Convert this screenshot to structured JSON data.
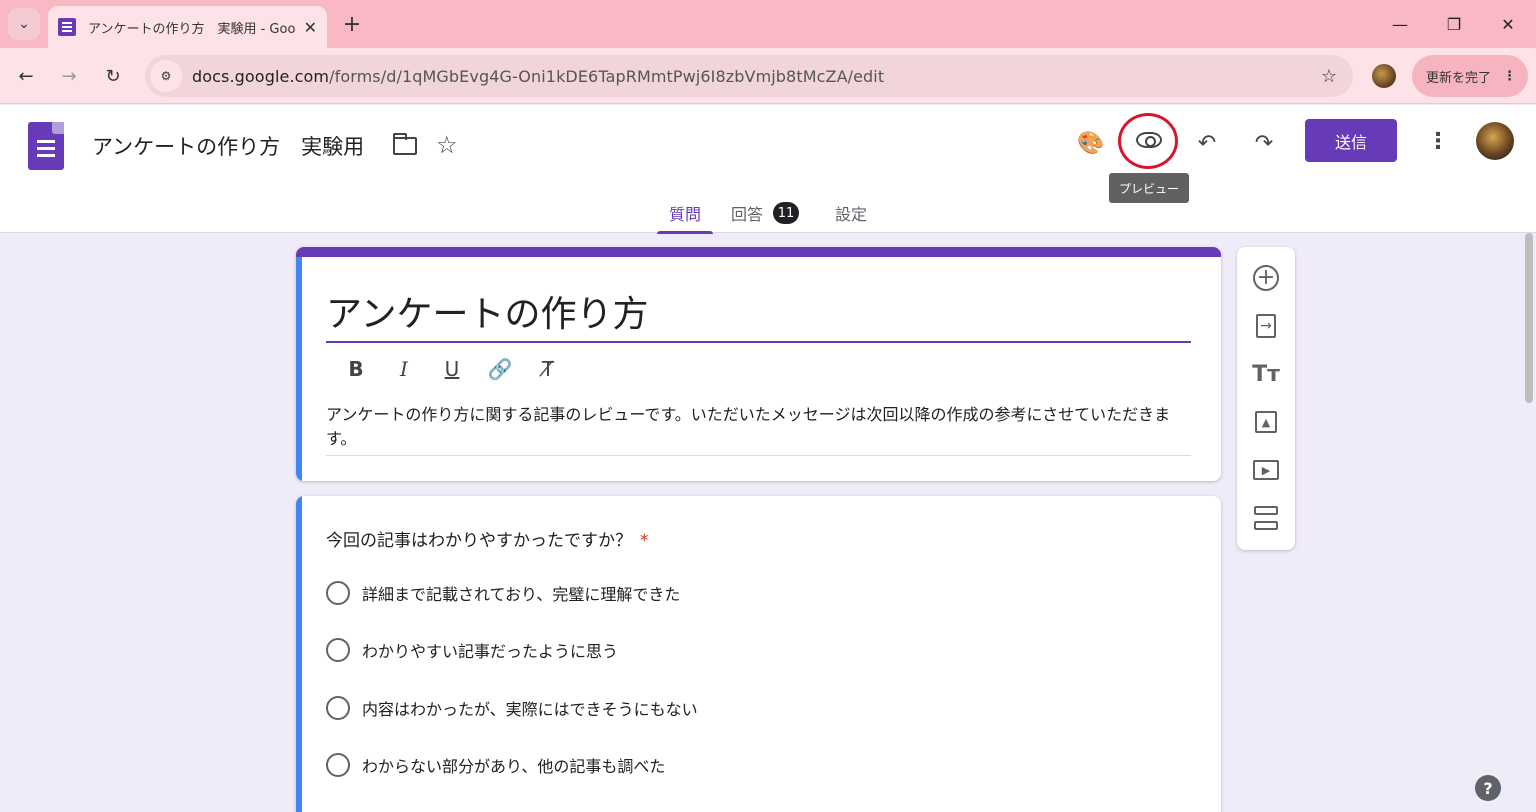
{
  "browser": {
    "tab_title": "アンケートの作り方　実験用 - Goo",
    "new_tab": "+",
    "close_tab": "✕",
    "url_host": "docs.google.com",
    "url_path": "/forms/d/1qMGbEvg4G-Oni1kDE6TapRMmtPwj6I8zbVmjb8tMcZA/edit",
    "update_label": "更新を完了",
    "window_controls": {
      "minimize": "—",
      "restore": "❐",
      "close": "✕"
    }
  },
  "header": {
    "form_title": "アンケートの作り方　実験用",
    "send_label": "送信",
    "preview_tooltip": "プレビュー",
    "tabs": [
      {
        "label": "質問"
      },
      {
        "label": "回答",
        "badge": "11"
      },
      {
        "label": "設定"
      }
    ]
  },
  "form": {
    "title": "アンケートの作り方",
    "description": "アンケートの作り方に関する記事のレビューです。いただいたメッセージは次回以降の作成の参考にさせていただきます。",
    "format": {
      "bold": "B",
      "italic": "I",
      "underline": "U"
    },
    "question": {
      "title": "今回の記事はわかりやすかったですか？",
      "required_mark": "*",
      "options": [
        "詳細まで記載されており、完璧に理解できた",
        "わかりやすい記事だったように思う",
        "内容はわかったが、実際にはできそうにもない",
        "わからない部分があり、他の記事も調べた"
      ]
    }
  },
  "colors": {
    "accent": "#673ab7",
    "active_bar": "#4285f4",
    "highlight_ring": "#d8162a",
    "required": "#d93025"
  },
  "help": "?"
}
